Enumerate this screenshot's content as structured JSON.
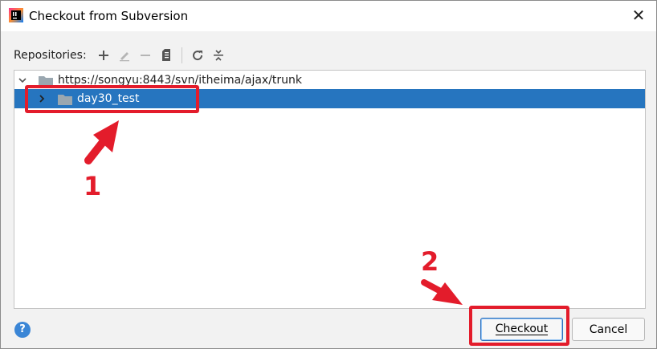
{
  "window": {
    "title": "Checkout from Subversion",
    "close_glyph": "✕"
  },
  "toolbar": {
    "label": "Repositories:",
    "icons": [
      "add-icon",
      "edit-icon",
      "remove-icon",
      "browse-icon",
      "refresh-icon",
      "collapse-all-icon"
    ]
  },
  "tree": {
    "root": {
      "label": "https://songyu:8443/svn/itheima/ajax/trunk",
      "expanded": true
    },
    "children": [
      {
        "label": "day30_test",
        "selected": true,
        "expanded": false
      }
    ]
  },
  "footer": {
    "help_glyph": "?",
    "checkout_label": "Checkout",
    "cancel_label": "Cancel"
  },
  "annotations": {
    "step1": "1",
    "step2": "2",
    "color": "#e31c2b"
  },
  "colors": {
    "selection": "#2675bf",
    "focus_border": "#2d6fbb"
  }
}
